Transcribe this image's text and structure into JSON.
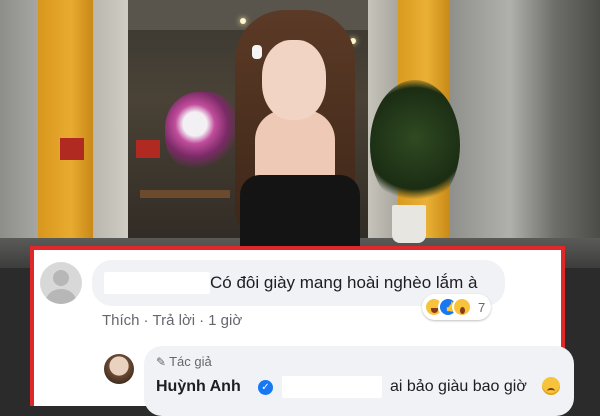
{
  "comment": {
    "text": "Có đôi giày mang hoài nghèo lắm à",
    "reactions": [
      "haha-icon",
      "like-icon",
      "wow-icon"
    ],
    "reaction_count": "7",
    "actions": {
      "like": "Thích",
      "reply": "Trả lời",
      "time": "1 giờ"
    }
  },
  "reply": {
    "author_tag": "Tác giả",
    "name": "Huỳnh Anh",
    "text": "ai bảo giàu bao giờ"
  },
  "colors": {
    "highlight_border": "#e0272a",
    "facebook_blue": "#1877f2",
    "bubble_bg": "#f0f2f5",
    "muted_text": "#65676b"
  }
}
